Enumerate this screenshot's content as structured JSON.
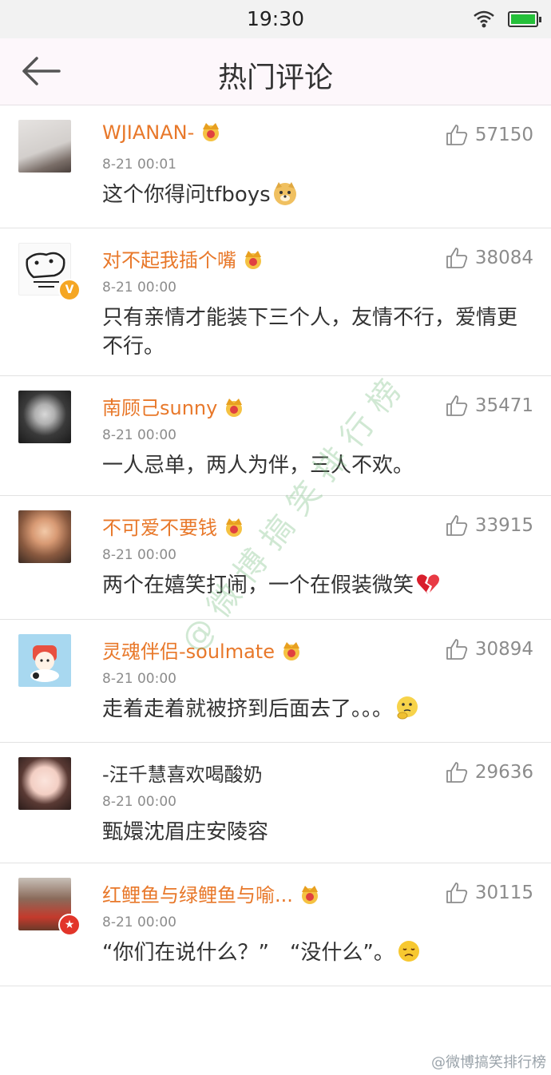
{
  "status_bar": {
    "time": "19:30"
  },
  "nav": {
    "title": "热门评论"
  },
  "comments": [
    {
      "username": "WJIANAN-",
      "time": "8-21 00:01",
      "text": "这个你得问tfboys",
      "likes": "57150",
      "vip": true,
      "emoji": "doge"
    },
    {
      "username": "对不起我插个嘴",
      "time": "8-21 00:00",
      "text": "只有亲情才能装下三个人，友情不行，爱情更不行。",
      "likes": "38084",
      "vip": true,
      "badge": "V"
    },
    {
      "username": "南顾己sunny",
      "time": "8-21 00:00",
      "text": "一人忌单，两人为伴，三人不欢。",
      "likes": "35471",
      "vip": true
    },
    {
      "username": "不可爱不要钱",
      "time": "8-21 00:00",
      "text": "两个在嬉笑打闹，一个在假装微笑",
      "likes": "33915",
      "vip": true,
      "emoji": "broken-heart"
    },
    {
      "username": "灵魂伴侣-soulmate",
      "time": "8-21 00:00",
      "text": "走着走着就被挤到后面去了。。。",
      "likes": "30894",
      "vip": true,
      "emoji": "thinking"
    },
    {
      "username": "-汪千慧喜欢喝酸奶",
      "time": "8-21 00:00",
      "text": "甄嬛沈眉庄安陵容",
      "likes": "29636",
      "vip": false
    },
    {
      "username": "红鲤鱼与绿鲤鱼与喻...",
      "time": "8-21 00:00",
      "text": "“你们在说什么？”　“没什么”。",
      "likes": "30115",
      "vip": true,
      "badge": "★",
      "emoji": "sad"
    }
  ],
  "watermark": "@微博搞笑排行榜",
  "footer_watermark": "@微博搞笑排行榜",
  "colors": {
    "username": "#e8782a",
    "meta": "#8c8c8c",
    "vip_crown": "#f0a020"
  }
}
